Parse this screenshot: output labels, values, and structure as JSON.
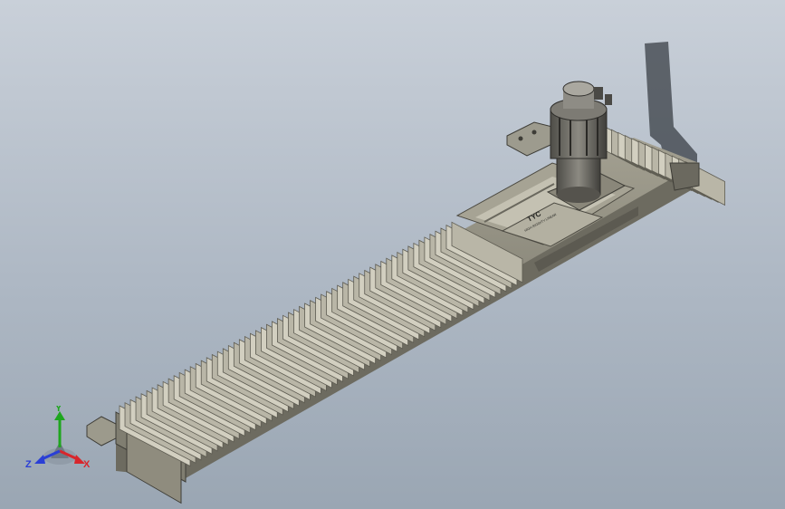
{
  "viewport": {
    "background_top": "#c9d0d9",
    "background_bottom": "#9aa6b3",
    "model": {
      "body_color": "#8a8878",
      "bellows_light": "#b9b6a7",
      "bellows_dark": "#5e5c52",
      "motor_color": "#6f6d66",
      "plate_text_brand": "TYC",
      "plate_text_model": "HIGH RIGIDITY LINEAR",
      "bellows_long_folds": 62,
      "bellows_short_folds": 14
    }
  },
  "triad": {
    "x_label": "X",
    "y_label": "Y",
    "z_label": "Z",
    "x_color": "#d8262c",
    "y_color": "#1ea61e",
    "z_color": "#2a3fd6"
  }
}
